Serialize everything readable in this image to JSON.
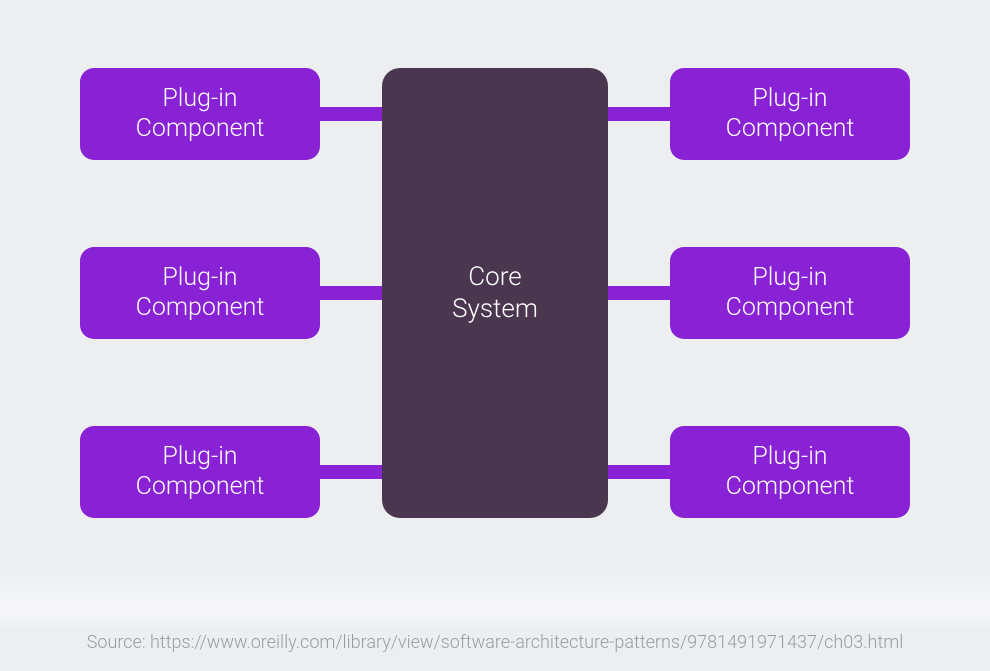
{
  "core": {
    "label": "Core\nSystem"
  },
  "plugins": {
    "left": [
      {
        "label": "Plug-in\nComponent"
      },
      {
        "label": "Plug-in\nComponent"
      },
      {
        "label": "Plug-in\nComponent"
      }
    ],
    "right": [
      {
        "label": "Plug-in\nComponent"
      },
      {
        "label": "Plug-in\nComponent"
      },
      {
        "label": "Plug-in\nComponent"
      }
    ]
  },
  "source": {
    "prefix": "Source: ",
    "url": "https://www.oreilly.com/library/view/software-architecture-patterns/9781491971437/ch03.html"
  },
  "colors": {
    "plugin": "#8921d5",
    "core": "#4a364f",
    "background": "#eceef0",
    "sourceText": "#9a9ca0"
  }
}
